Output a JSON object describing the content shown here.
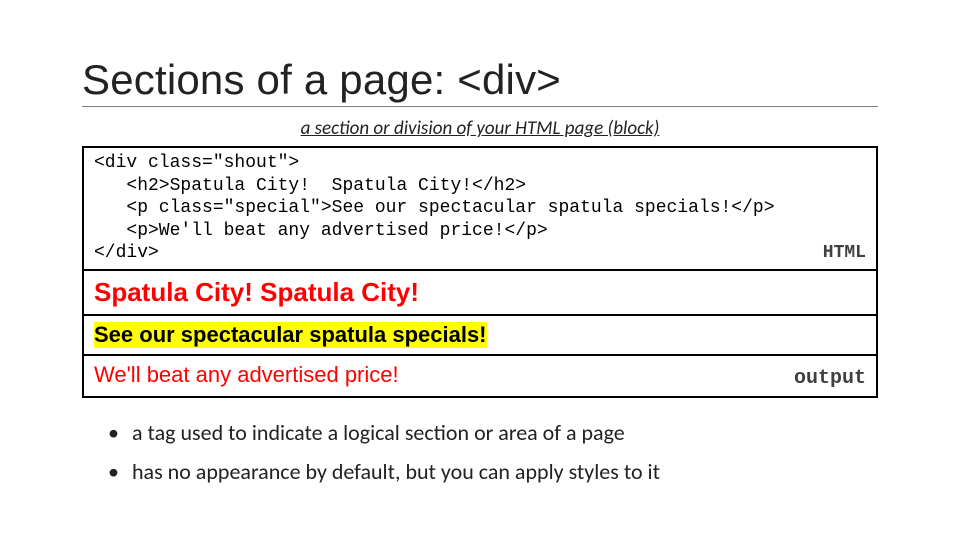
{
  "title": "Sections of a page: <div>",
  "subtitle": "a section or division of your HTML page (block)",
  "code": {
    "line1": "<div class=\"shout\">",
    "line2": "   <h2>Spatula City!  Spatula City!</h2>",
    "line3": "   <p class=\"special\">See our spectacular spatula specials!</p>",
    "line4": "   <p>We'll beat any advertised price!</p>",
    "line5": "</div>",
    "label": "HTML"
  },
  "output": {
    "heading": "Spatula City! Spatula City!",
    "special": "See our spectacular spatula specials!",
    "para": "We'll beat any advertised price!",
    "label": "output"
  },
  "bullets": [
    "a tag used to indicate a logical section or area of a page",
    "has no appearance by default, but you can apply styles to it"
  ]
}
